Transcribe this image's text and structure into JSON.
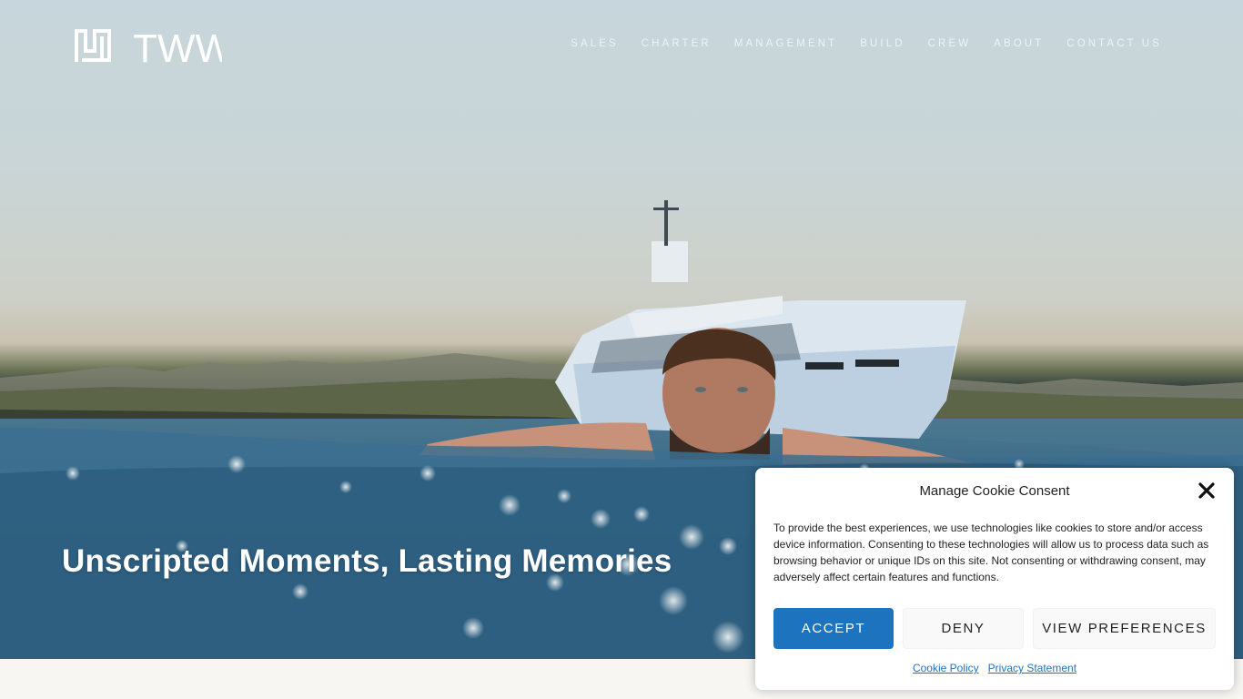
{
  "brand": {
    "name": "TWW"
  },
  "nav": {
    "items": [
      "SALES",
      "CHARTER",
      "MANAGEMENT",
      "BUILD",
      "CREW",
      "ABOUT",
      "CONTACT US"
    ]
  },
  "hero": {
    "headline": "Unscripted Moments, Lasting Memories",
    "image_description": "yacht-and-swimmer-photo"
  },
  "cookie": {
    "title": "Manage Cookie Consent",
    "body": "To provide the best experiences, we use technologies like cookies to store and/or access device information. Consenting to these technologies will allow us to process data such as browsing behavior or unique IDs on this site. Not consenting or withdrawing consent, may adversely affect certain features and functions.",
    "accept_label": "ACCEPT",
    "deny_label": "DENY",
    "preferences_label": "VIEW PREFERENCES",
    "cookie_policy_label": "Cookie Policy",
    "privacy_label": "Privacy Statement"
  },
  "colors": {
    "accent": "#1e73be",
    "page_bg": "#f8f6f2"
  }
}
